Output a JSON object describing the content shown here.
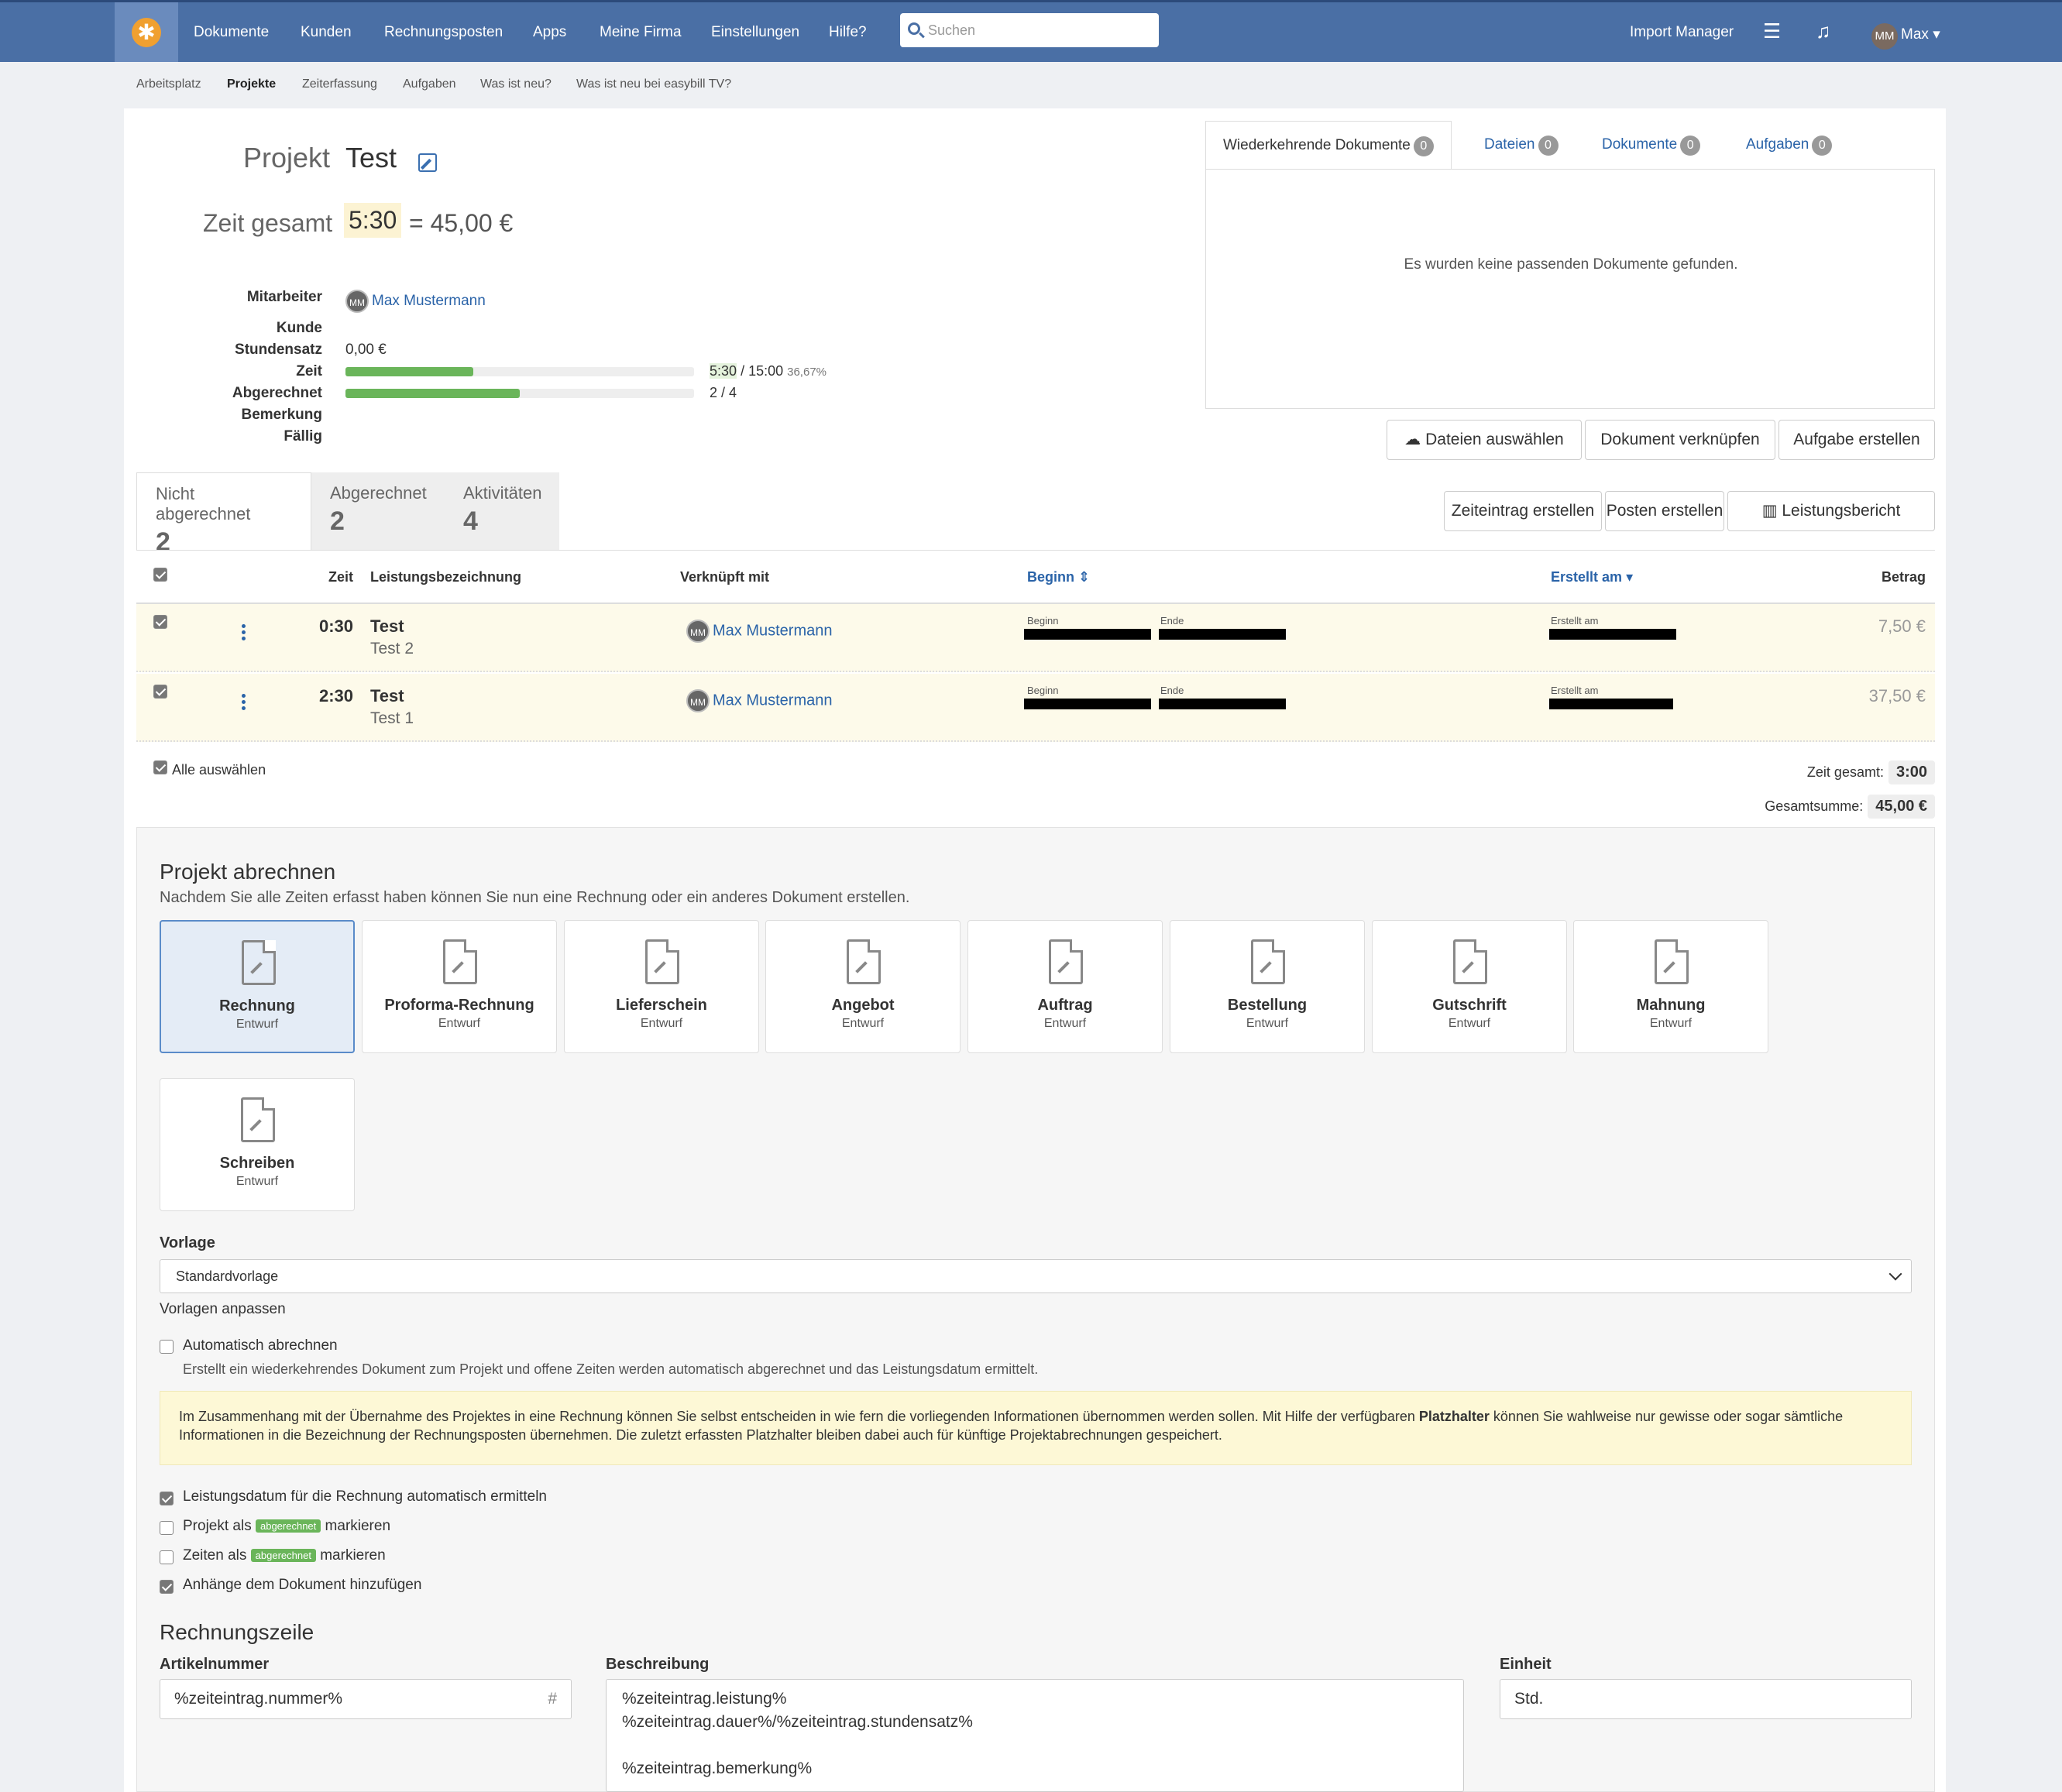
{
  "nav": {
    "items": [
      "Dokumente",
      "Kunden",
      "Rechnungsposten",
      "Apps",
      "Meine Firma",
      "Einstellungen",
      "Hilfe?"
    ],
    "search_placeholder": "Suchen",
    "import_manager": "Import Manager",
    "user_initials": "MM",
    "user_name": "Max"
  },
  "subnav": [
    "Arbeitsplatz",
    "Projekte",
    "Zeiterfassung",
    "Aufgaben",
    "Was ist neu?",
    "Was ist neu bei easybill TV?"
  ],
  "project": {
    "label": "Projekt",
    "name": "Test",
    "zeit_label": "Zeit gesamt",
    "zeit_value": "5:30",
    "zeit_eq": "= 45,00 €",
    "fields": {
      "mitarbeiter_label": "Mitarbeiter",
      "mitarbeiter_initials": "MM",
      "mitarbeiter": "Max Mustermann",
      "kunde_label": "Kunde",
      "stundensatz_label": "Stundensatz",
      "stundensatz": "0,00 €",
      "zeit_label": "Zeit",
      "zeit_progress": 0.3667,
      "zeit_done": "5:30",
      "zeit_total": "/ 15:00",
      "zeit_pct": "36,67%",
      "abgerechnet_label": "Abgerechnet",
      "abgerechnet_progress": 0.5,
      "abgerechnet_text": "2 / 4",
      "bemerkung_label": "Bemerkung",
      "faellig_label": "Fällig"
    }
  },
  "right_tabs": [
    {
      "label": "Wiederkehrende Dokumente",
      "count": "0"
    },
    {
      "label": "Dateien",
      "count": "0"
    },
    {
      "label": "Dokumente",
      "count": "0"
    },
    {
      "label": "Aufgaben",
      "count": "0"
    }
  ],
  "right_empty": "Es wurden keine passenden Dokumente gefunden.",
  "buttons": {
    "dateien": "Dateien auswählen",
    "verknuepfen": "Dokument verknüpfen",
    "aufgabe": "Aufgabe erstellen",
    "zeiteintrag": "Zeiteintrag erstellen",
    "posten": "Posten erstellen",
    "leistungsbericht": "Leistungsbericht"
  },
  "left_tabs": [
    {
      "label": "Nicht abgerechnet",
      "count": "2"
    },
    {
      "label": "Abgerechnet",
      "count": "2"
    },
    {
      "label": "Aktivitäten",
      "count": "4"
    }
  ],
  "table": {
    "headers": {
      "zeit": "Zeit",
      "leistung": "Leistungsbezeichnung",
      "verknuepft": "Verknüpft mit",
      "beginn": "Beginn",
      "erstellt": "Erstellt am",
      "betrag": "Betrag"
    },
    "rows": [
      {
        "time": "0:30",
        "title": "Test",
        "sub": "Test 2",
        "initials": "MM",
        "person": "Max Mustermann",
        "beginn": "Beginn",
        "ende": "Ende",
        "erstellt": "Erstellt am",
        "amount": "7,50 €"
      },
      {
        "time": "2:30",
        "title": "Test",
        "sub": "Test 1",
        "initials": "MM",
        "person": "Max Mustermann",
        "beginn": "Beginn",
        "ende": "Ende",
        "erstellt": "Erstellt am",
        "amount": "37,50 €"
      }
    ]
  },
  "footer": {
    "alle": "Alle auswählen",
    "zeit_label": "Zeit gesamt:",
    "zeit_value": "3:00",
    "summe_label": "Gesamtsumme:",
    "summe_value": "45,00 €"
  },
  "abrechnen": {
    "title": "Projekt abrechnen",
    "subtitle": "Nachdem Sie alle Zeiten erfasst haben können Sie nun eine Rechnung oder ein anderes Dokument erstellen.",
    "docs": [
      {
        "name": "Rechnung",
        "state": "Entwurf"
      },
      {
        "name": "Proforma-Rechnung",
        "state": "Entwurf"
      },
      {
        "name": "Lieferschein",
        "state": "Entwurf"
      },
      {
        "name": "Angebot",
        "state": "Entwurf"
      },
      {
        "name": "Auftrag",
        "state": "Entwurf"
      },
      {
        "name": "Bestellung",
        "state": "Entwurf"
      },
      {
        "name": "Gutschrift",
        "state": "Entwurf"
      },
      {
        "name": "Mahnung",
        "state": "Entwurf"
      },
      {
        "name": "Schreiben",
        "state": "Entwurf"
      }
    ],
    "vorlage_label": "Vorlage",
    "vorlage_value": "Standardvorlage",
    "vorlagen_link": "Vorlagen anpassen",
    "auto_label": "Automatisch abrechnen",
    "auto_hint": "Erstellt ein wiederkehrendes Dokument zum Projekt und offene Zeiten werden automatisch abgerechnet und das Leistungsdatum ermittelt.",
    "notice_pre": "Im Zusammenhang mit der Übernahme des Projektes in eine Rechnung können Sie selbst entscheiden in wie fern die vorliegenden Informationen übernommen werden sollen. Mit Hilfe der verfügbaren ",
    "notice_bold": "Platzhalter",
    "notice_post": " können Sie wahlweise nur gewisse oder sogar sämtliche Informationen in die Bezeichnung der Rechnungsposten übernehmen. Die zuletzt erfassten Platzhalter bleiben dabei auch für künftige Projektabrechnungen gespeichert.",
    "opt1": "Leistungsdatum für die Rechnung automatisch ermitteln",
    "opt2_pre": "Projekt als",
    "opt_tag": "abgerechnet",
    "opt2_post": "markieren",
    "opt3_pre": "Zeiten als",
    "opt3_post": "markieren",
    "opt4": "Anhänge dem Dokument hinzufügen"
  },
  "rechnungszeile": {
    "title": "Rechnungszeile",
    "artikel_label": "Artikelnummer",
    "artikel_value": "%zeiteintrag.nummer%",
    "hash": "#",
    "beschreibung_label": "Beschreibung",
    "beschreibung_value": "%zeiteintrag.leistung%\n%zeiteintrag.dauer%/%zeiteintrag.stundensatz%\n\n%zeiteintrag.bemerkung%",
    "einheit_label": "Einheit",
    "einheit_value": "Std."
  },
  "colors": {
    "nav": "#4a6fa5",
    "accent": "#2a63a8",
    "progress": "#6ab55a",
    "logo": "#f0a030"
  }
}
